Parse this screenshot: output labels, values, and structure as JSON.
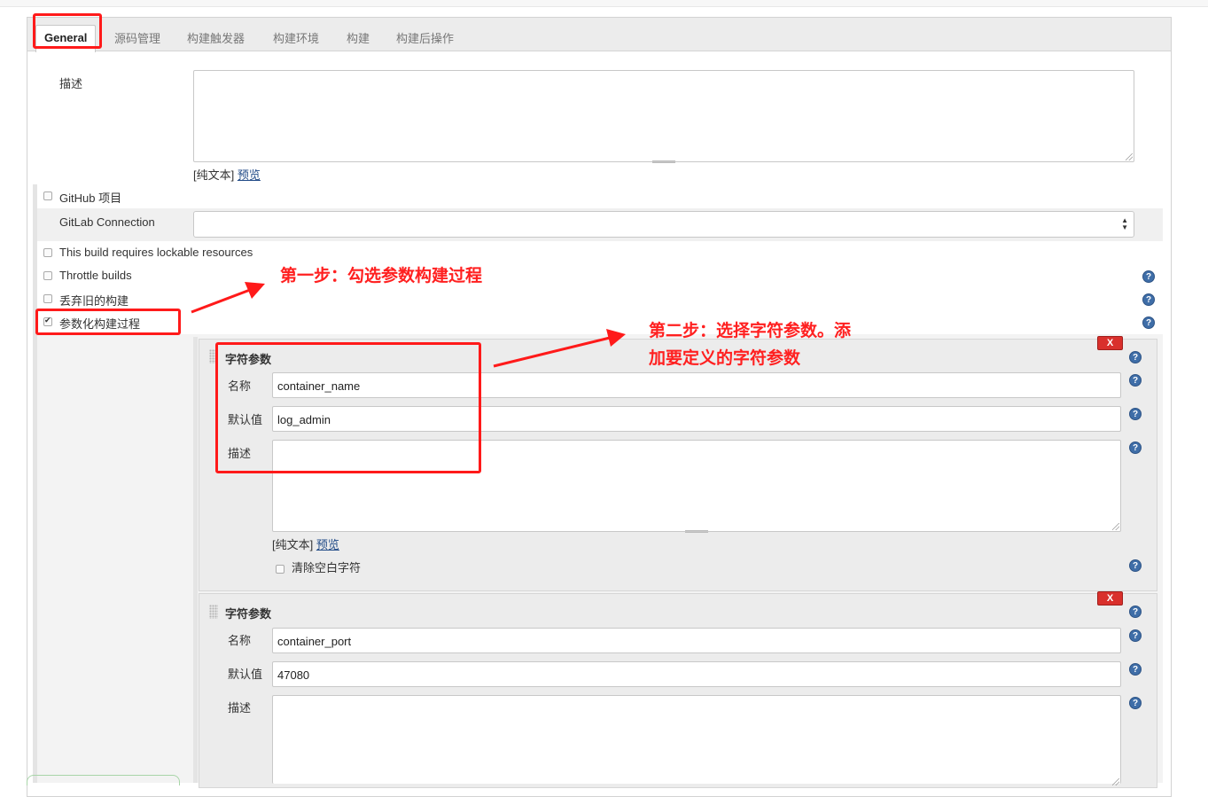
{
  "tabs": [
    "General",
    "源码管理",
    "构建触发器",
    "构建环境",
    "构建",
    "构建后操作"
  ],
  "description": {
    "label": "描述",
    "plain_text": "[纯文本]",
    "preview": "预览"
  },
  "options": {
    "github_project": "GitHub 项目",
    "gitlab_connection": "GitLab Connection",
    "gitlab_connection_value": "",
    "lockable": "This build requires lockable resources",
    "throttle": "Throttle builds",
    "discard_old": "丢弃旧的构建",
    "parameterized": "参数化构建过程"
  },
  "params": [
    {
      "type_label": "字符参数",
      "name_label": "名称",
      "name_value": "container_name",
      "default_label": "默认值",
      "default_value": "log_admin",
      "desc_label": "描述",
      "plain_text": "[纯文本]",
      "preview": "预览",
      "trim_label": "清除空白字符",
      "delete": "X"
    },
    {
      "type_label": "字符参数",
      "name_label": "名称",
      "name_value": "container_port",
      "default_label": "默认值",
      "default_value": "47080",
      "desc_label": "描述",
      "delete": "X"
    }
  ],
  "help_icon": "?",
  "annotations": {
    "step1": "第一步：勾选参数构建过程",
    "step2_line1": "第二步：选择字符参数。添",
    "step2_line2": "加要定义的字符参数"
  },
  "colors": {
    "annotation_red": "#ff1a1a",
    "help_blue": "#3f6ea8",
    "delete_red": "#d9302c",
    "link_blue": "#204a87"
  }
}
